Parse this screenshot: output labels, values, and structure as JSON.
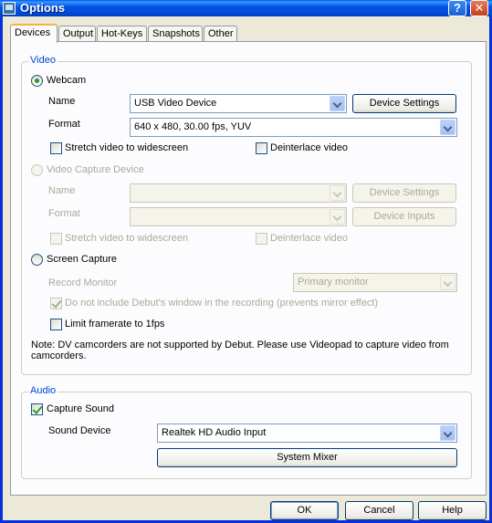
{
  "window": {
    "title": "Options"
  },
  "tabs": [
    "Devices",
    "Output",
    "Hot-Keys",
    "Snapshots",
    "Other"
  ],
  "video": {
    "group_label": "Video",
    "webcam": {
      "label": "Webcam",
      "name_label": "Name",
      "name_value": "USB Video Device",
      "device_settings": "Device Settings",
      "format_label": "Format",
      "format_value": "640 x 480, 30.00 fps, YUV",
      "stretch_label": "Stretch video to widescreen",
      "deinterlace_label": "Deinterlace video"
    },
    "capture_device": {
      "label": "Video Capture Device",
      "name_label": "Name",
      "device_settings": "Device Settings",
      "format_label": "Format",
      "device_inputs": "Device Inputs",
      "stretch_label": "Stretch video to widescreen",
      "deinterlace_label": "Deinterlace video"
    },
    "screen_capture": {
      "label": "Screen Capture",
      "record_monitor_label": "Record Monitor",
      "record_monitor_value": "Primary monitor",
      "exclude_window_label": "Do not include Debut's window in the recording (prevents mirror effect)",
      "limit_framerate_label": "Limit framerate to 1fps"
    },
    "note": "Note: DV camcorders are not supported by Debut. Please use Videopad to capture video from camcorders."
  },
  "audio": {
    "group_label": "Audio",
    "capture_sound_label": "Capture Sound",
    "sound_device_label": "Sound Device",
    "sound_device_value": "Realtek HD Audio Input",
    "system_mixer": "System Mixer"
  },
  "footer": {
    "ok": "OK",
    "cancel": "Cancel",
    "help": "Help"
  },
  "titlebar_buttons": {
    "help": "?",
    "close": "✕"
  }
}
